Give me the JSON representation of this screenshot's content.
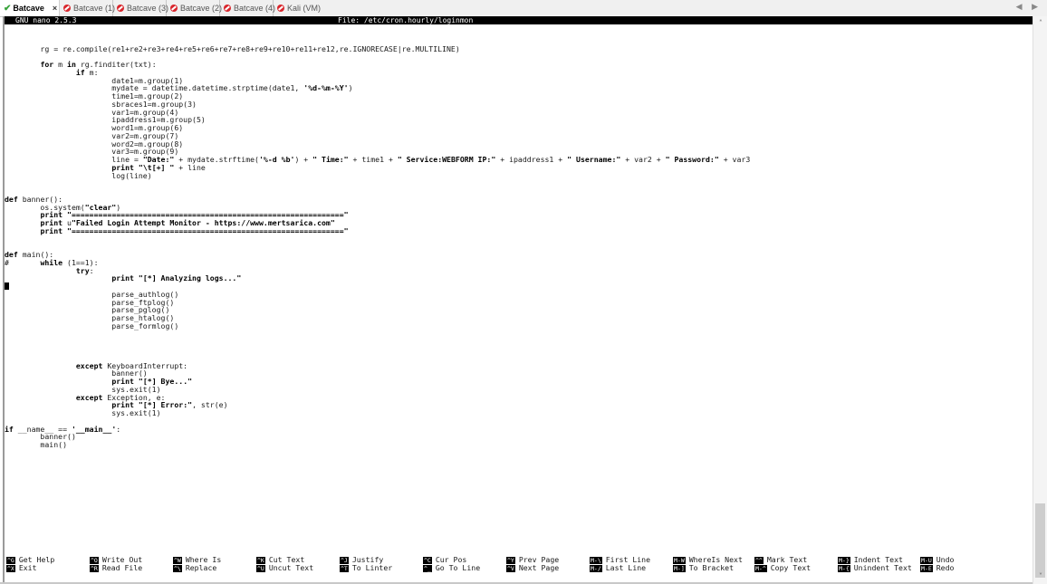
{
  "tabs": [
    {
      "label": "Batcave",
      "active": true,
      "status_icon": "check-icon",
      "closable": true
    },
    {
      "label": "Batcave (1)",
      "active": false,
      "status_icon": "disconnected-icon"
    },
    {
      "label": "Batcave (3)",
      "active": false,
      "status_icon": "disconnected-icon"
    },
    {
      "label": "Batcave (2)",
      "active": false,
      "status_icon": "disconnected-icon"
    },
    {
      "label": "Batcave (4)",
      "active": false,
      "status_icon": "disconnected-icon"
    },
    {
      "label": "Kali (VM)",
      "active": false,
      "status_icon": "disconnected-icon"
    }
  ],
  "tab_close_label": "×",
  "nav_arrows": "◀ ▶",
  "nano": {
    "version": "GNU nano 2.5.3",
    "file": "File: /etc/cron.hourly/loginmon"
  },
  "code_lines": [
    "",
    "",
    "        rg = re.compile(re1+re2+re3+re4+re5+re6+re7+re8+re9+re10+re11+re12,re.IGNORECASE|re.MULTILINE)",
    "",
    "        for m in rg.finditer(txt):",
    "                if m:",
    "                        date1=m.group(1)",
    "                        mydate = datetime.datetime.strptime(date1, '%d-%m-%Y')",
    "                        time1=m.group(2)",
    "                        sbraces1=m.group(3)",
    "                        var1=m.group(4)",
    "                        ipaddress1=m.group(5)",
    "                        word1=m.group(6)",
    "                        var2=m.group(7)",
    "                        word2=m.group(8)",
    "                        var3=m.group(9)",
    "                        line = \"Date:\" + mydate.strftime('%-d %b') + \" Time:\" + time1 + \" Service:WEBFORM IP:\" + ipaddress1 + \" Username:\" + var2 + \" Password:\" + var3",
    "                        print \"\\t[+] \" + line",
    "                        log(line)",
    "",
    "",
    "def banner():",
    "        os.system(\"clear\")",
    "        print \"=============================================================\"",
    "        print u\"Failed Login Attempt Monitor - https://www.mertsarica.com\"",
    "        print \"=============================================================\"",
    "",
    "",
    "def main():",
    "#       while (1==1):",
    "                try:",
    "                        print \"[*] Analyzing logs...\"",
    "",
    "                        parse_authlog()",
    "                        parse_ftplog()",
    "                        parse_pglog()",
    "                        parse_htalog()",
    "                        parse_formlog()",
    "",
    "",
    "",
    "",
    "                except KeyboardInterrupt:",
    "                        banner()",
    "                        print \"[*] Bye...\"",
    "                        sys.exit(1)",
    "                except Exception, e:",
    "                        print \"[*] Error:\", str(e)",
    "                        sys.exit(1)",
    "",
    "if __name__ == '__main__':",
    "        banner()",
    "        main()"
  ],
  "cursor_row": 32,
  "shortcuts": [
    {
      "key1": "^G",
      "label1": "Get Help",
      "key2": "^X",
      "label2": "Exit"
    },
    {
      "key1": "^O",
      "label1": "Write Out",
      "key2": "^R",
      "label2": "Read File"
    },
    {
      "key1": "^W",
      "label1": "Where Is",
      "key2": "^\\",
      "label2": "Replace"
    },
    {
      "key1": "^K",
      "label1": "Cut Text",
      "key2": "^U",
      "label2": "Uncut Text"
    },
    {
      "key1": "^J",
      "label1": "Justify",
      "key2": "^T",
      "label2": "To Linter"
    },
    {
      "key1": "^C",
      "label1": "Cur Pos",
      "key2": "^_",
      "label2": "Go To Line"
    },
    {
      "key1": "^Y",
      "label1": "Prev Page",
      "key2": "^V",
      "label2": "Next Page"
    },
    {
      "key1": "M-\\",
      "label1": "First Line",
      "key2": "M-/",
      "label2": "Last Line"
    },
    {
      "key1": "M-W",
      "label1": "WhereIs Next",
      "key2": "M-]",
      "label2": "To Bracket"
    },
    {
      "key1": "^^",
      "label1": "Mark Text",
      "key2": "M-^",
      "label2": "Copy Text"
    },
    {
      "key1": "M-}",
      "label1": "Indent Text",
      "key2": "M-{",
      "label2": "Unindent Text"
    },
    {
      "key1": "M-U",
      "label1": "Undo",
      "key2": "M-E",
      "label2": "Redo"
    }
  ],
  "scrollbar": {
    "up": "˄",
    "down": "˅",
    "position_fraction": 0.86
  }
}
